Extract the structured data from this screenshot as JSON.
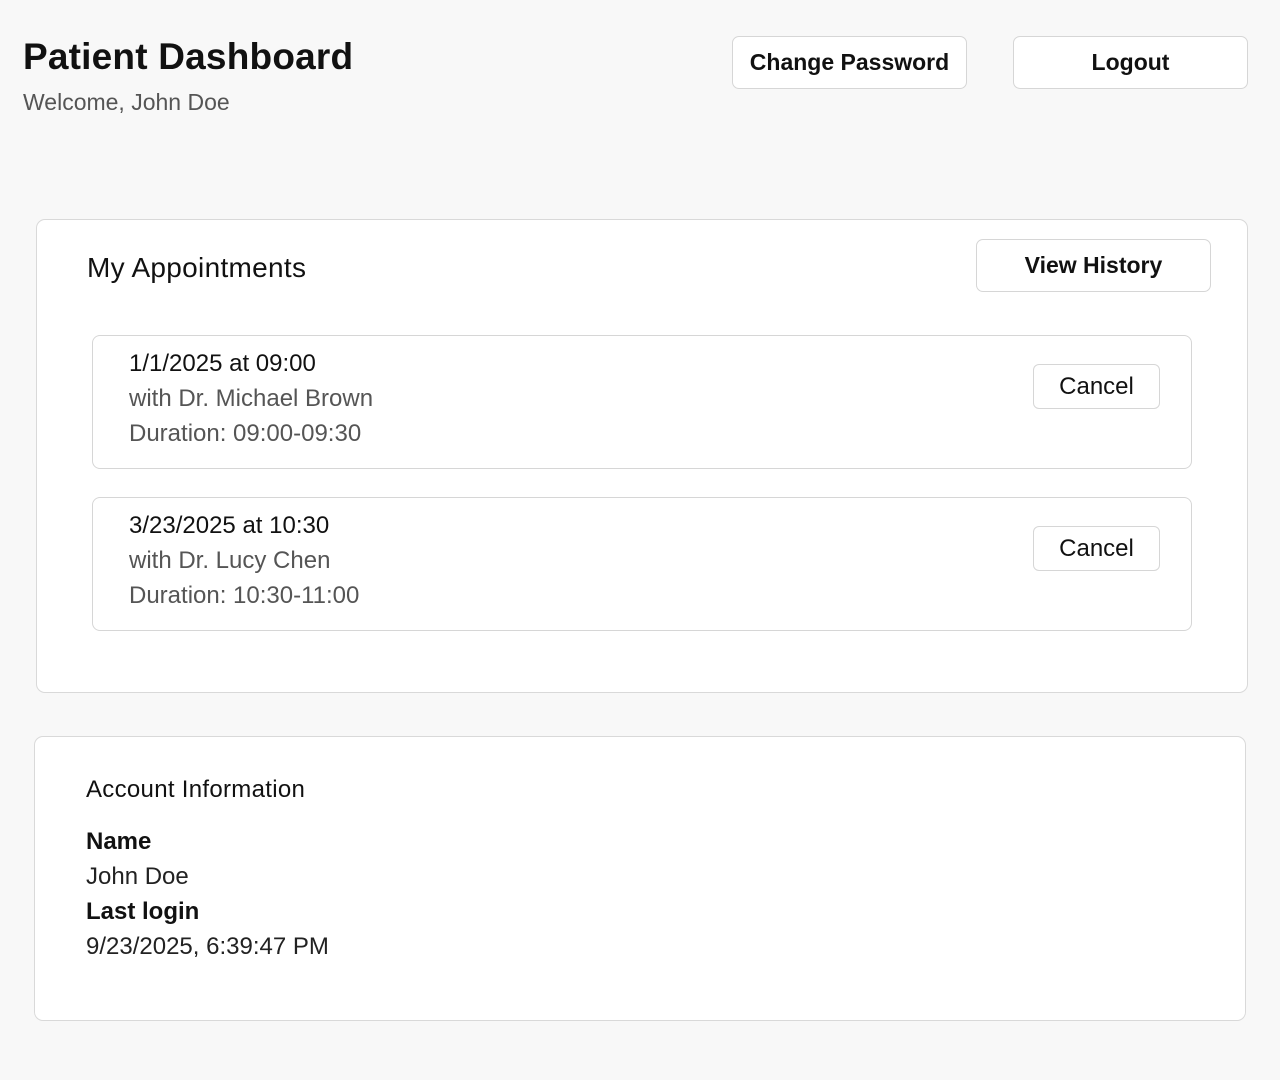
{
  "header": {
    "title": "Patient Dashboard",
    "welcome": "Welcome, John Doe",
    "change_password_label": "Change Password",
    "logout_label": "Logout"
  },
  "appointments": {
    "title": "My Appointments",
    "view_history_label": "View History",
    "items": [
      {
        "when": "1/1/2025 at 09:00",
        "doctor": "with Dr. Michael Brown",
        "duration": "Duration: 09:00-09:30",
        "cancel_label": "Cancel"
      },
      {
        "when": "3/23/2025 at 10:30",
        "doctor": "with Dr. Lucy Chen",
        "duration": "Duration: 10:30-11:00",
        "cancel_label": "Cancel"
      }
    ]
  },
  "account": {
    "title": "Account Information",
    "name_label": "Name",
    "name_value": "John Doe",
    "last_login_label": "Last login",
    "last_login_value": "9/23/2025, 6:39:47 PM"
  },
  "colors": {
    "background": "#f8f8f8",
    "card": "#ffffff",
    "border": "#d9d9d9",
    "text": "#111111",
    "muted_text": "#555555"
  }
}
